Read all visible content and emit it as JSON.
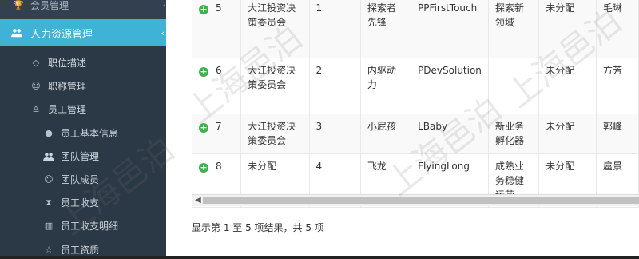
{
  "sidebar": {
    "top_item": "会员管理",
    "active_item": "人力资源管理",
    "items": [
      {
        "label": "职位描述",
        "icon": "diamond-icon"
      },
      {
        "label": "职称管理",
        "icon": "user-outline-icon"
      },
      {
        "label": "员工管理",
        "icon": "user-tie-icon"
      }
    ],
    "sub_items": [
      {
        "label": "员工基本信息",
        "icon": "user-icon"
      },
      {
        "label": "团队管理",
        "icon": "users-icon"
      },
      {
        "label": "团队成员",
        "icon": "user-outline-icon"
      },
      {
        "label": "员工收支",
        "icon": "hourglass-icon"
      },
      {
        "label": "员工收支明细",
        "icon": "map-icon"
      },
      {
        "label": "员工资质",
        "icon": "star-icon"
      }
    ]
  },
  "table": {
    "rows": [
      {
        "id": "5",
        "committee": "大江投资决策委员会",
        "num": "1",
        "name": "探索者先锋",
        "code": "PPFirstTouch",
        "domain": "探索新领域",
        "status": "未分配",
        "extra": "毛琳"
      },
      {
        "id": "6",
        "committee": "大江投资决策委员会",
        "num": "2",
        "name": "内驱动力",
        "code": "PDevSolution",
        "domain": "",
        "status": "未分配",
        "extra": "方芳"
      },
      {
        "id": "7",
        "committee": "大江投资决策委员会",
        "num": "3",
        "name": "小屁孩",
        "code": "LBaby",
        "domain": "新业务孵化器",
        "status": "未分配",
        "extra": "郭峰"
      },
      {
        "id": "8",
        "committee": "未分配",
        "num": "4",
        "name": "飞龙",
        "code": "FlyingLong",
        "domain": "成熟业务稳健运营",
        "status": "未分配",
        "extra": "扈景"
      }
    ]
  },
  "footer": {
    "summary": "显示第 1 至 5 项结果，共 5 项"
  },
  "watermark": {
    "text": "上海邑泊"
  }
}
